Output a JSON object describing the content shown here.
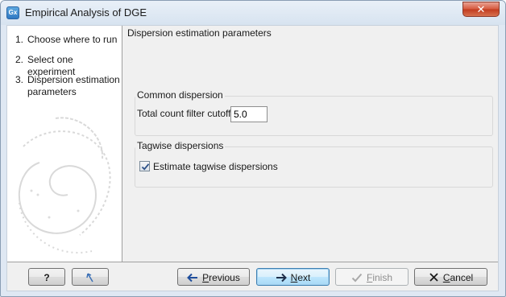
{
  "window": {
    "title": "Empirical Analysis of DGE",
    "app_icon_text": "Gx",
    "close_symbol": "✕"
  },
  "steps": [
    {
      "num": "1.",
      "label": "Choose where to run"
    },
    {
      "num": "2.",
      "label": "Select one experiment"
    },
    {
      "num": "3.",
      "label": "Dispersion estimation parameters"
    }
  ],
  "main": {
    "header": "Dispersion estimation parameters",
    "common_dispersion": {
      "title": "Common dispersion",
      "filter_label": "Total count filter cutoff",
      "filter_value": "5.0"
    },
    "tagwise_dispersions": {
      "title": "Tagwise dispersions",
      "estimate_label": "Estimate tagwise dispersions",
      "estimate_checked": true
    }
  },
  "buttons": {
    "help": "?",
    "previous_prefix": "",
    "previous_underlined": "P",
    "previous_rest": "revious",
    "next_underlined": "N",
    "next_rest": "ext",
    "finish_underlined": "F",
    "finish_rest": "inish",
    "cancel_underlined": "C",
    "cancel_rest": "ancel"
  },
  "colors": {
    "accent": "#3c7fb1",
    "close_button": "#c13b1f",
    "arrow_blue": "#1f4e9c"
  },
  "icons": {
    "help": "question-mark",
    "reset": "reset-arrow-icon",
    "previous": "left-arrow-icon",
    "next": "right-arrow-icon",
    "finish": "checkmark-icon",
    "cancel": "x-icon"
  }
}
